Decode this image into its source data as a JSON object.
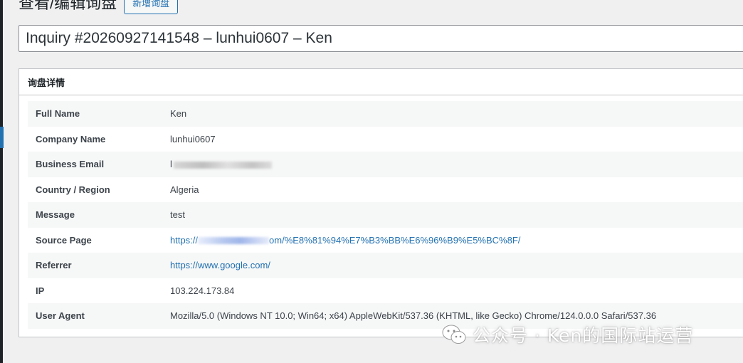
{
  "header": {
    "title": "查看/编辑询盘",
    "add_button": "新增询盘"
  },
  "post_title": "Inquiry #20260927141548 – lunhui0607 – Ken",
  "box": {
    "title": "询盘详情",
    "rows": [
      {
        "label": "Full Name",
        "value": "Ken"
      },
      {
        "label": "Company Name",
        "value": "lunhui0607"
      },
      {
        "label": "Business Email",
        "value": "l"
      },
      {
        "label": "Country / Region",
        "value": "Algeria"
      },
      {
        "label": "Message",
        "value": "test"
      },
      {
        "label": "Source Page",
        "value_prefix": "https://",
        "value_suffix": "om/%E8%81%94%E7%B3%BB%E6%96%B9%E5%BC%8F/"
      },
      {
        "label": "Referrer",
        "value": "https://www.google.com/"
      },
      {
        "label": "IP",
        "value": "103.224.173.84"
      },
      {
        "label": "User Agent",
        "value": "Mozilla/5.0 (Windows NT 10.0; Win64; x64) AppleWebKit/537.36 (KHTML, like Gecko) Chrome/124.0.0.0 Safari/537.36"
      }
    ]
  },
  "watermark": {
    "text": "公众号 · Ken的国际站运营",
    "icon": "wechat-icon"
  },
  "colors": {
    "link": "#2271b1",
    "background": "#f0f0f1"
  }
}
